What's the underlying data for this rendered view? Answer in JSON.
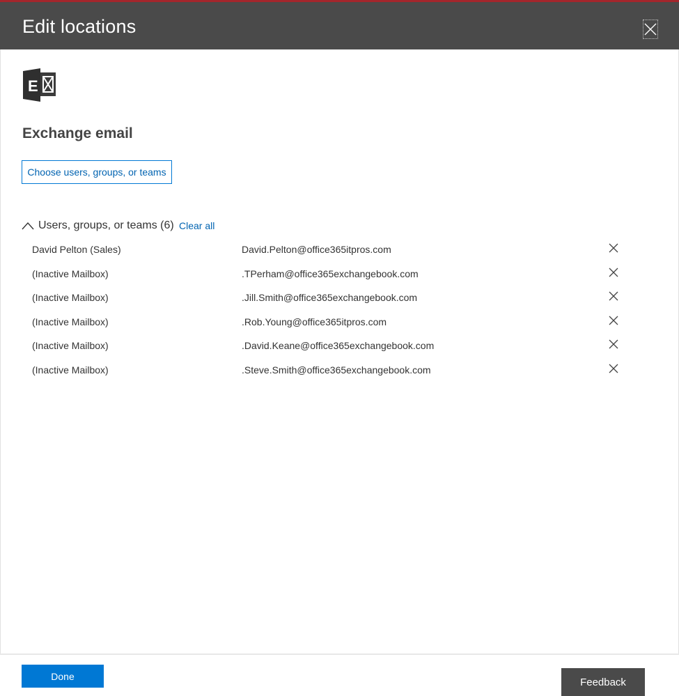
{
  "header": {
    "title": "Edit locations",
    "close_icon": "close-icon"
  },
  "section": {
    "app_icon": "exchange-logo-icon",
    "title": "Exchange email",
    "choose_button": "Choose users, groups, or teams"
  },
  "group": {
    "label": "Users, groups, or teams (6)",
    "clear_all": "Clear all",
    "rows": [
      {
        "name": "David Pelton (Sales)",
        "email": "David.Pelton@office365itpros.com"
      },
      {
        "name": "(Inactive Mailbox)",
        "email": ".TPerham@office365exchangebook.com"
      },
      {
        "name": "(Inactive Mailbox)",
        "email": ".Jill.Smith@office365exchangebook.com"
      },
      {
        "name": "(Inactive Mailbox)",
        "email": ".Rob.Young@office365itpros.com"
      },
      {
        "name": "(Inactive Mailbox)",
        "email": ".David.Keane@office365exchangebook.com"
      },
      {
        "name": "(Inactive Mailbox)",
        "email": ".Steve.Smith@office365exchangebook.com"
      }
    ]
  },
  "footer": {
    "done": "Done",
    "feedback": "Feedback"
  },
  "colors": {
    "header_bg": "#4a4a4a",
    "accent": "#0078d4",
    "top_line": "#a4262c"
  }
}
